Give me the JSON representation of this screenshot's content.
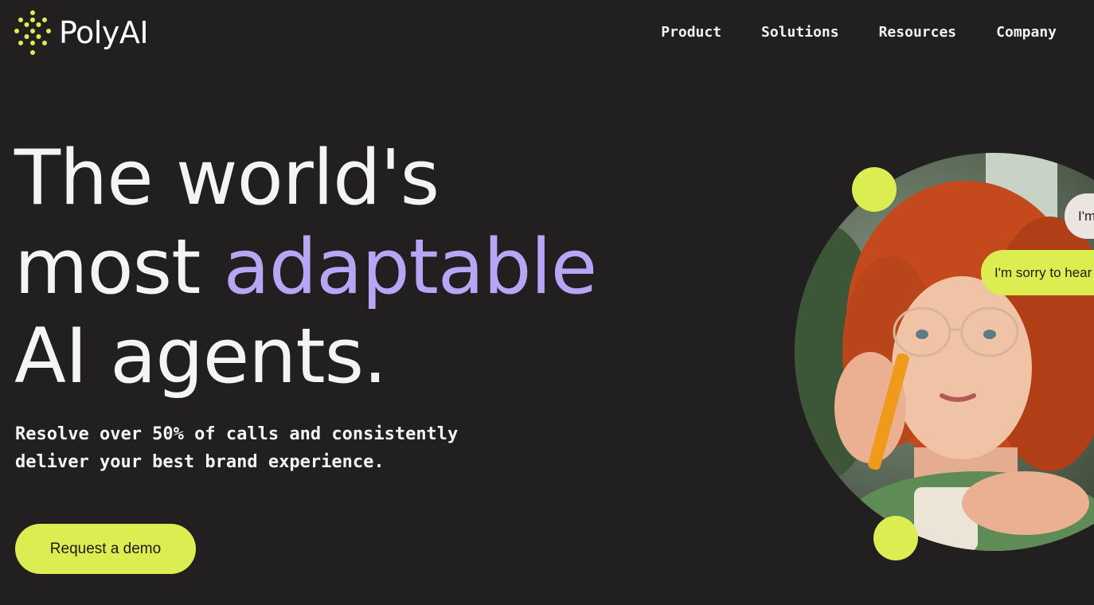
{
  "header": {
    "logo_text": "PolyAI",
    "nav": [
      "Product",
      "Solutions",
      "Resources",
      "Company"
    ]
  },
  "hero": {
    "title_line1": "The world's",
    "title_line2_prefix": "most ",
    "title_line2_accent": "adaptable",
    "title_line3": "AI agents.",
    "subtitle_line1": "Resolve over 50% of calls and consistently",
    "subtitle_line2": "deliver your best brand experience.",
    "cta_label": "Request a demo"
  },
  "visual": {
    "chat_bubbles": [
      "I'm",
      "I'm sorry to hear"
    ]
  },
  "colors": {
    "background": "#221f20",
    "accent_lime": "#dced52",
    "accent_purple": "#b9a5f5",
    "text": "#f4f4f4"
  },
  "icons": {
    "logo": "dot-grid-logo-icon"
  }
}
